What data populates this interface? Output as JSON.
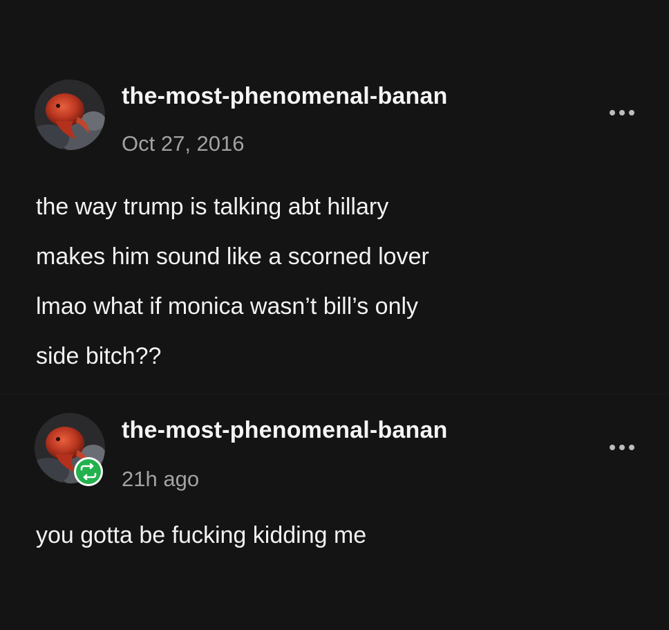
{
  "posts": [
    {
      "username": "the-most-phenomenal-banan",
      "timestamp": "Oct 27, 2016",
      "body_lines": [
        "the way trump is talking abt hillary",
        "makes him sound like a scorned lover",
        "lmao what if monica wasn’t bill’s only",
        "side bitch??"
      ],
      "more_icon": "ellipsis-icon"
    },
    {
      "username": "the-most-phenomenal-banan",
      "timestamp": "21h ago",
      "body_lines": [
        "you gotta be fucking kidding me"
      ],
      "more_icon": "ellipsis-icon",
      "badge_icon": "reblog-icon"
    }
  ],
  "colors": {
    "background": "#141414",
    "text": "#f2f2f2",
    "muted": "#a3a3a3",
    "reblog_green": "#22b14c"
  }
}
